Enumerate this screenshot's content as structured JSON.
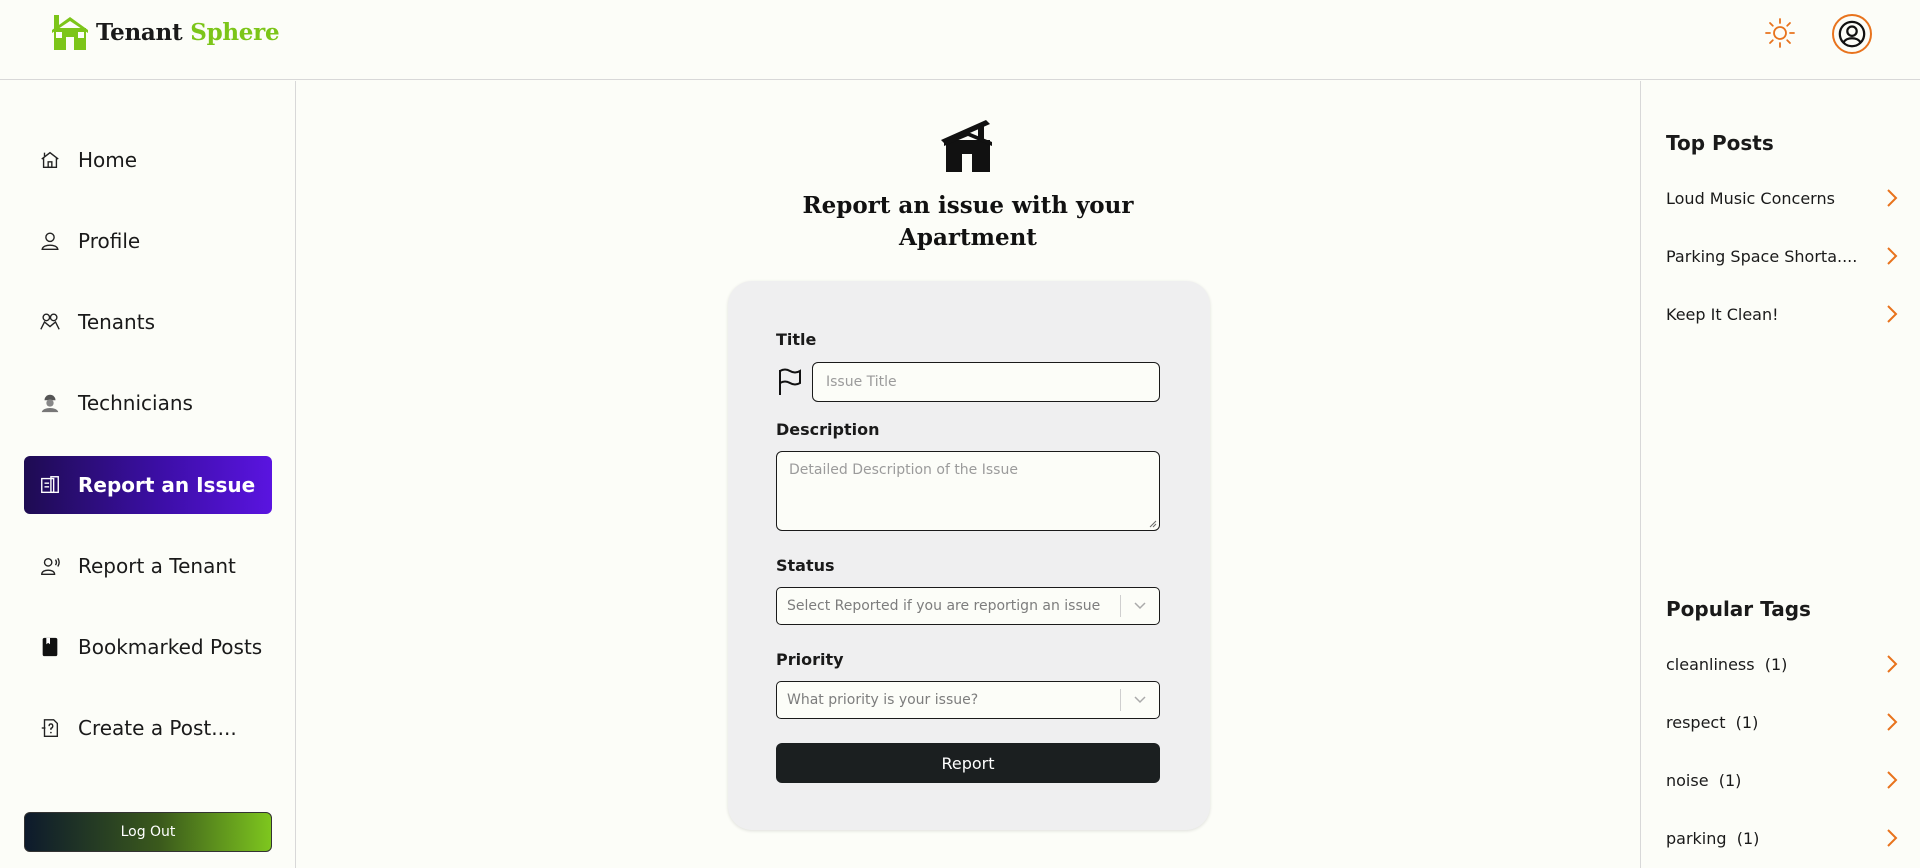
{
  "header": {
    "brand_part1": "Tenant",
    "brand_part2": "Sphere",
    "logo_icon": "house-icon",
    "theme_icon": "sun-icon",
    "profile_icon": "user-circle-icon",
    "brand_color": "#7cc519",
    "accent_color": "#e8731d"
  },
  "sidebar": {
    "items": [
      {
        "label": "Home",
        "icon": "home-icon"
      },
      {
        "label": "Profile",
        "icon": "user-icon"
      },
      {
        "label": "Tenants",
        "icon": "users-icon"
      },
      {
        "label": "Technicians",
        "icon": "technician-icon"
      },
      {
        "label": "Report an Issue",
        "icon": "report-issue-icon",
        "active": true
      },
      {
        "label": "Report a Tenant",
        "icon": "report-tenant-icon"
      },
      {
        "label": "Bookmarked Posts",
        "icon": "bookmark-icon"
      },
      {
        "label": "Create a Post....",
        "icon": "create-post-icon"
      }
    ],
    "logout_label": "Log Out"
  },
  "main": {
    "title": "Report an issue with your Apartment",
    "form": {
      "title_label": "Title",
      "title_placeholder": "Issue Title",
      "description_label": "Description",
      "description_placeholder": "Detailed Description of the Issue",
      "status_label": "Status",
      "status_placeholder": "Select Reported if you are reportign an issue",
      "priority_label": "Priority",
      "priority_placeholder": "What priority is your issue?",
      "submit_label": "Report"
    }
  },
  "rightbar": {
    "top_posts_title": "Top Posts",
    "top_posts": [
      "Loud Music Concerns",
      "Parking Space Shorta....",
      "Keep It Clean!"
    ],
    "tags_title": "Popular Tags",
    "tags": [
      "cleanliness  (1)",
      "respect  (1)",
      "noise  (1)",
      "parking  (1)"
    ]
  }
}
